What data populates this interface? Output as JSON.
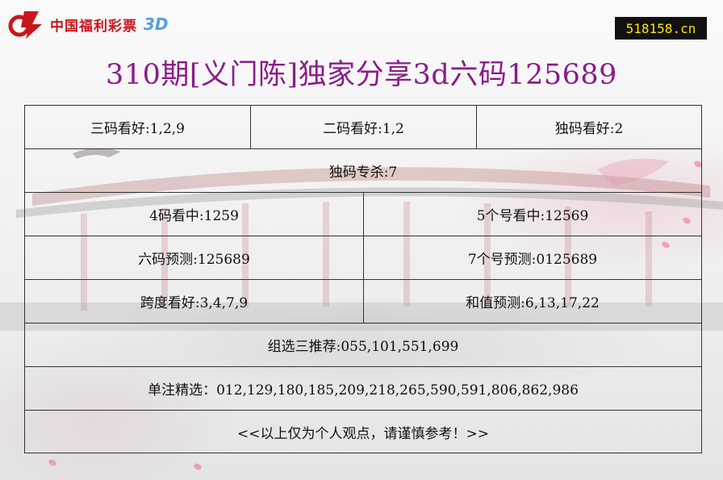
{
  "header": {
    "brand_text": "中国福利彩票",
    "brand_3d": "3D",
    "site_badge": "518158.cn"
  },
  "title": "310期[义门陈]独家分享3d六码125689",
  "rows": [
    [
      "三码看好:1,2,9",
      "二码看好:1,2",
      "独码看好:2"
    ],
    [
      "独码专杀:7"
    ],
    [
      "4码看中:1259",
      "5个号看中:12569"
    ],
    [
      "六码预测:125689",
      "7个号预测:0125689"
    ],
    [
      "跨度看好:3,4,7,9",
      "和值预测:6,13,17,22"
    ],
    [
      "组选三推荐:055,101,551,699"
    ],
    [
      "单注精选：012,129,180,185,209,218,265,590,591,806,862,986"
    ],
    [
      "<<以上仅为个人观点，请谨慎参考！>>"
    ]
  ],
  "colors": {
    "title": "#8b1c8b",
    "brand_red": "#c8161d",
    "brand_blue": "#5a9dd8",
    "badge_bg": "#111111",
    "badge_text": "#ffe400"
  }
}
